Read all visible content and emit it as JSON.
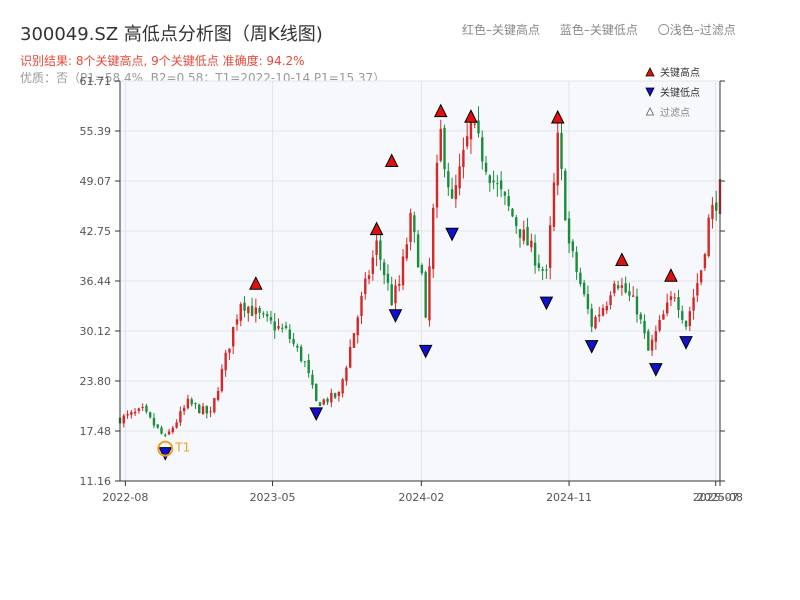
{
  "header": {
    "title": "300049.SZ 高低点分析图（周K线图)",
    "result_line": "识别结果: 8个关键高点, 9个关键低点   准确度: 94.2%",
    "metrics_line": "优质：否（P1=58.4%, B2=0.58；T1=2022-10-14 P1=15.37）"
  },
  "top_legend": {
    "red": "红色–关键高点",
    "blue": "蓝色–关键低点",
    "light": "〇浅色–过滤点"
  },
  "colors": {
    "up": "#d62728",
    "down": "#1a8c3b",
    "high_marker": "#e01010",
    "low_marker": "#1010d0",
    "t1_ring": "#f0a020",
    "plot_bg": "#f7f8fb",
    "grid": "#dfe3ea"
  },
  "chart_data": {
    "type": "candlestick",
    "x_axis": {
      "start": "2022-07-22",
      "end": "2025-08-08",
      "ticks": [
        "2022-08",
        "2023-05",
        "2024-02",
        "2024-11",
        "2025-07",
        "2025-08"
      ]
    },
    "y_axis": {
      "min": 11.16,
      "max": 61.71,
      "ticks": [
        11.16,
        17.48,
        23.8,
        30.12,
        36.44,
        42.75,
        49.07,
        55.39,
        61.71
      ]
    },
    "grid": true,
    "legend": {
      "placement": "top-right",
      "items": [
        "关键高点",
        "关键低点",
        "过滤点"
      ]
    },
    "t1_label": "T1",
    "close_path": [
      [
        "2022-07-22",
        19.0
      ],
      [
        "2022-09-02",
        20.0
      ],
      [
        "2022-10-14",
        16.5
      ],
      [
        "2022-11-25",
        21.0
      ],
      [
        "2023-01-06",
        19.5
      ],
      [
        "2023-03-03",
        34.0
      ],
      [
        "2023-04-14",
        31.5
      ],
      [
        "2023-05-26",
        30.0
      ],
      [
        "2023-06-30",
        26.0
      ],
      [
        "2023-07-21",
        21.0
      ],
      [
        "2023-09-01",
        22.0
      ],
      [
        "2023-10-13",
        34.0
      ],
      [
        "2023-11-10",
        41.0
      ],
      [
        "2023-12-08",
        34.0
      ],
      [
        "2023-12-22",
        36.0
      ],
      [
        "2024-01-12",
        44.0
      ],
      [
        "2024-02-02",
        37.0
      ],
      [
        "2024-02-09",
        31.0
      ],
      [
        "2024-02-23",
        45.0
      ],
      [
        "2024-03-08",
        55.0
      ],
      [
        "2024-03-29",
        46.0
      ],
      [
        "2024-05-03",
        56.0
      ],
      [
        "2024-06-14",
        49.0
      ],
      [
        "2024-08-09",
        42.0
      ],
      [
        "2024-09-20",
        37.0
      ],
      [
        "2024-10-11",
        54.0
      ],
      [
        "2024-11-01",
        41.0
      ],
      [
        "2024-12-13",
        31.0
      ],
      [
        "2025-01-10",
        34.0
      ],
      [
        "2025-01-24",
        37.0
      ],
      [
        "2025-03-07",
        33.0
      ],
      [
        "2025-03-28",
        27.5
      ],
      [
        "2025-04-25",
        32.0
      ],
      [
        "2025-05-16",
        35.0
      ],
      [
        "2025-06-06",
        31.0
      ],
      [
        "2025-07-04",
        38.0
      ],
      [
        "2025-07-18",
        44.0
      ],
      [
        "2025-08-08",
        48.0
      ]
    ],
    "key_highs": [
      {
        "date": "2023-03-31",
        "price": 35.4
      },
      {
        "date": "2023-11-10",
        "price": 42.3
      },
      {
        "date": "2023-12-08",
        "price": 50.9
      },
      {
        "date": "2024-03-08",
        "price": 57.2
      },
      {
        "date": "2024-05-03",
        "price": 56.5
      },
      {
        "date": "2024-10-11",
        "price": 56.4
      },
      {
        "date": "2025-02-07",
        "price": 38.4
      },
      {
        "date": "2025-05-09",
        "price": 36.4
      }
    ],
    "key_lows": [
      {
        "date": "2022-10-14",
        "price": 15.37
      },
      {
        "date": "2023-07-21",
        "price": 20.4
      },
      {
        "date": "2023-12-15",
        "price": 32.8
      },
      {
        "date": "2024-02-09",
        "price": 28.3
      },
      {
        "date": "2024-03-29",
        "price": 43.1
      },
      {
        "date": "2024-09-20",
        "price": 34.4
      },
      {
        "date": "2024-12-13",
        "price": 28.9
      },
      {
        "date": "2025-04-11",
        "price": 26.0
      },
      {
        "date": "2025-06-06",
        "price": 29.4
      }
    ]
  }
}
